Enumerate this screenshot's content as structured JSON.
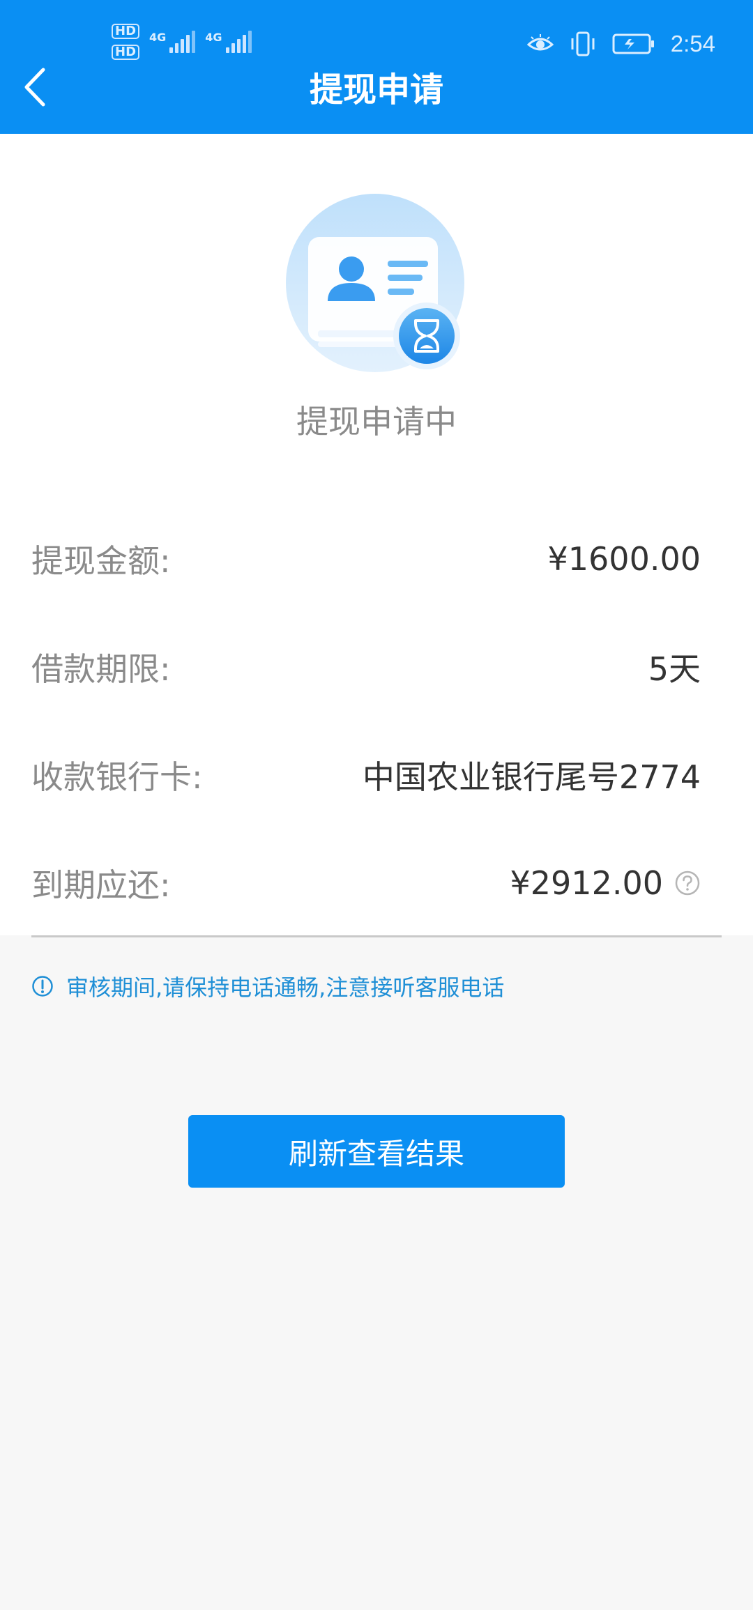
{
  "status_bar": {
    "hd1": "HD",
    "hd2": "HD",
    "net1": "4G",
    "net2": "4G",
    "time": "2:54"
  },
  "header": {
    "title": "提现申请",
    "back_icon": "chevron-left-icon",
    "bg_color": "#0a8ff3"
  },
  "status": {
    "text": "提现申请中",
    "icon": "id-card-hourglass-icon"
  },
  "details": [
    {
      "label": "提现金额:",
      "value": "¥1600.00"
    },
    {
      "label": "借款期限:",
      "value": "5天"
    },
    {
      "label": "收款银行卡:",
      "value": "中国农业银行尾号2774"
    },
    {
      "label": "到期应还:",
      "value": "¥2912.00",
      "help_icon": "question-circle-icon"
    }
  ],
  "notice": {
    "icon": "info-circle-icon",
    "text": "审核期间,请保持电话通畅,注意接听客服电话"
  },
  "button": {
    "label": "刷新查看结果"
  },
  "colors": {
    "primary": "#0a8ff3",
    "notice": "#1f8fd6",
    "label_gray": "#8a8a8a"
  }
}
